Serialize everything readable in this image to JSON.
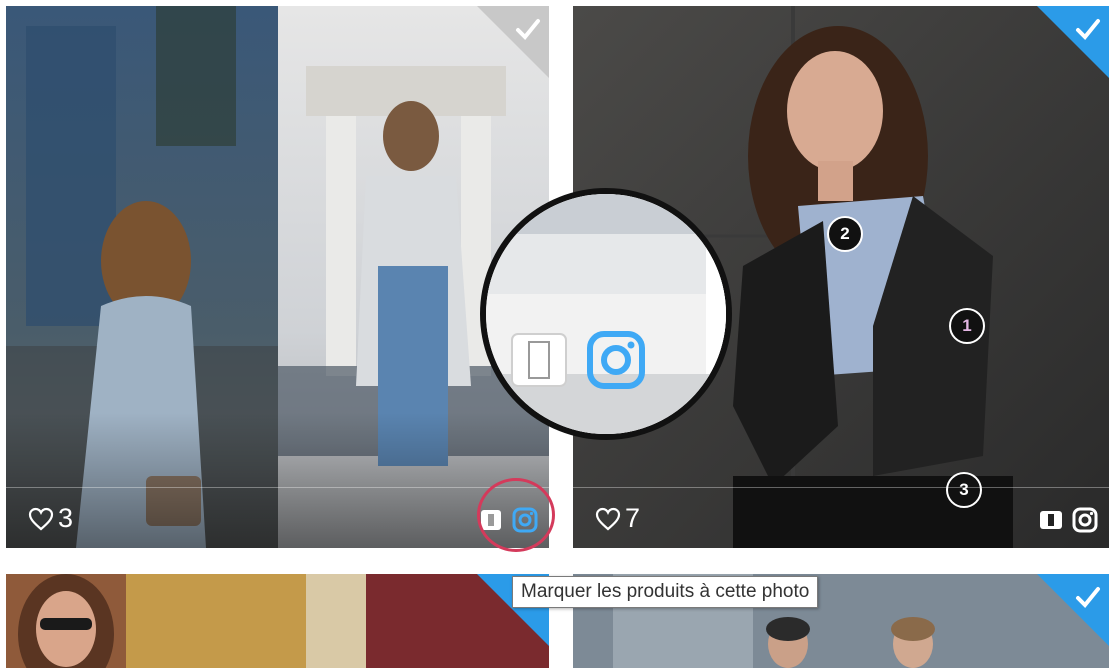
{
  "colors": {
    "accent_blue": "#2b9be8",
    "highlight_ring": "#d43a5b",
    "instagram_selected": "#3fa9f5"
  },
  "cards": [
    {
      "id": "card-1",
      "likes": "3",
      "selected": true,
      "check_style": "white-check-gray-triangle",
      "actions": [
        "product-tag-icon",
        "instagram-icon"
      ],
      "instagram_highlighted": true
    },
    {
      "id": "card-2",
      "likes": "7",
      "selected": true,
      "check_style": "white-check-blue-triangle",
      "actions": [
        "product-tag-icon",
        "instagram-icon"
      ],
      "hotspots": [
        "1",
        "2",
        "3"
      ]
    },
    {
      "id": "card-3",
      "selected": true,
      "check_style": "blue-triangle"
    },
    {
      "id": "card-4",
      "selected": true,
      "check_style": "white-check-blue-triangle"
    }
  ],
  "tooltip": {
    "text": "Marquer les produits à cette photo"
  },
  "magnifier": {
    "shows": [
      "product-tag-icon",
      "instagram-icon"
    ]
  }
}
